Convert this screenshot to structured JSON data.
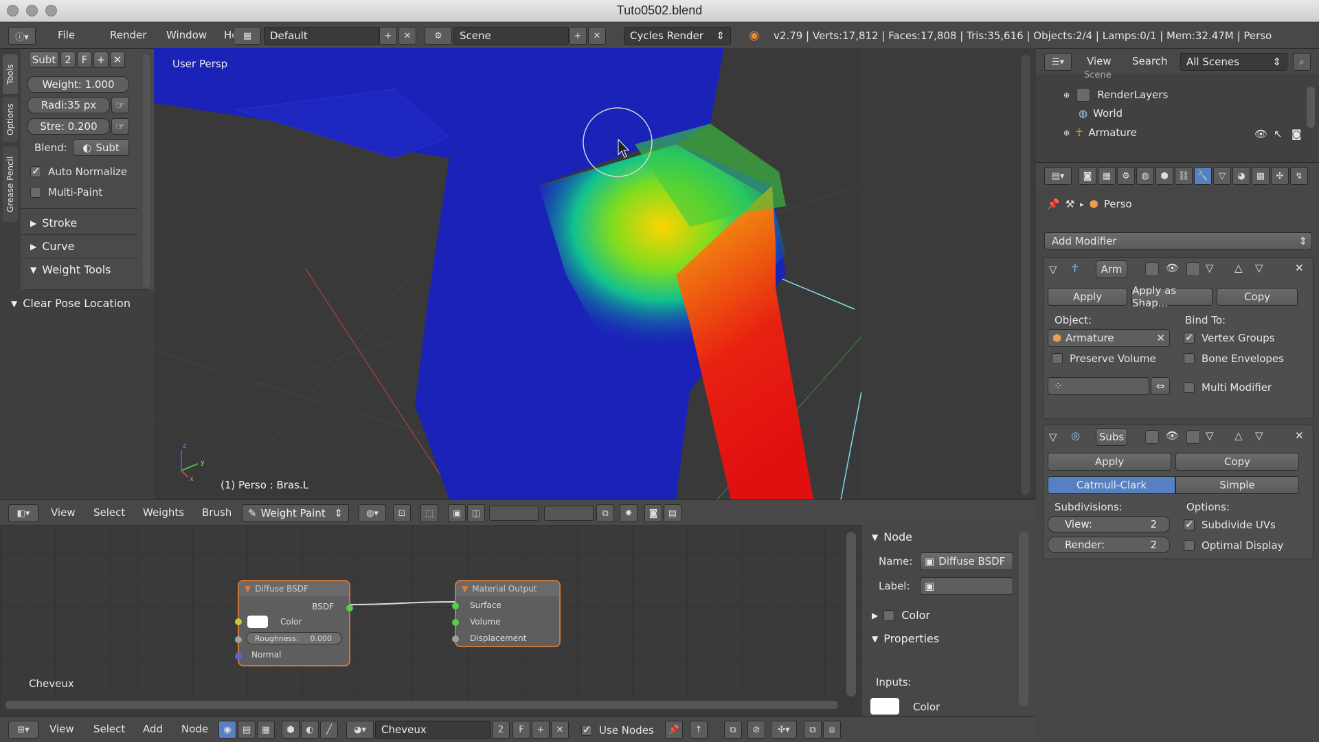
{
  "window": {
    "title": "Tuto0502.blend"
  },
  "infobar": {
    "menus": [
      "File",
      "Render",
      "Window",
      "Help"
    ],
    "layout": "Default",
    "scene": "Scene",
    "engine": "Cycles Render",
    "stats": "v2.79 | Verts:17,812 | Faces:17,808 | Tris:35,616 | Objects:2/4 | Lamps:0/1 | Mem:32.47M | Perso"
  },
  "tools": {
    "tabs": [
      "Tools",
      "Options",
      "Grease Pencil"
    ],
    "brush_name": "Subt",
    "brush_users": "2",
    "brush_fake": "F",
    "weight": "Weight:  1.000",
    "radius": "Radi:35 px",
    "strength": "Stre:  0.200",
    "blend_label": "Blend:",
    "blend_value": "Subt",
    "auto_normalize": "Auto Normalize",
    "multi_paint": "Multi-Paint",
    "stroke": "Stroke",
    "curve": "Curve",
    "weight_tools": "Weight Tools",
    "clear_pose": "Clear Pose Location"
  },
  "viewport": {
    "label": "User Persp",
    "status": "(1) Perso : Bras.L",
    "axis_x": "x",
    "axis_y": "y",
    "axis_z": "z"
  },
  "viewheader": {
    "menus": [
      "View",
      "Select",
      "Weights",
      "Brush"
    ],
    "mode": "Weight Paint"
  },
  "nodes": {
    "diffuse": {
      "title": "Diffuse BSDF",
      "bsdf": "BSDF",
      "color": "Color",
      "roughness": "Roughness:",
      "roughness_value": "0.000",
      "normal": "Normal"
    },
    "output": {
      "title": "Material Output",
      "surface": "Surface",
      "volume": "Volume",
      "displacement": "Displacement"
    },
    "material_label": "Cheveux"
  },
  "nodepanel": {
    "node": "Node",
    "name_label": "Name:",
    "name_value": "Diffuse BSDF",
    "label_label": "Label:",
    "color": "Color",
    "properties": "Properties",
    "inputs": "Inputs:",
    "color_input": "Color"
  },
  "nodeheader": {
    "menus": [
      "View",
      "Select",
      "Add",
      "Node"
    ],
    "material": "Cheveux",
    "users": "2",
    "fake": "F",
    "use_nodes": "Use Nodes"
  },
  "outliner": {
    "menus": [
      "View",
      "Search"
    ],
    "filter": "All Scenes",
    "items": [
      "Scene",
      "RenderLayers",
      "World",
      "Armature"
    ]
  },
  "properties": {
    "breadcrumb": "Perso",
    "add_modifier": "Add Modifier",
    "armature_mod": {
      "name": "Arm",
      "apply": "Apply",
      "apply_shape": "Apply as Shap...",
      "copy": "Copy",
      "object_label": "Object:",
      "object_value": "Armature",
      "bind_to": "Bind To:",
      "vertex_groups": "Vertex Groups",
      "preserve_volume": "Preserve Volume",
      "bone_envelopes": "Bone Envelopes",
      "multi_modifier": "Multi Modifier"
    },
    "subsurf_mod": {
      "name": "Subs",
      "apply": "Apply",
      "copy": "Copy",
      "catmull": "Catmull-Clark",
      "simple": "Simple",
      "subdivisions": "Subdivisions:",
      "options": "Options:",
      "view": "View:",
      "view_value": "2",
      "render": "Render:",
      "render_value": "2",
      "subdivide_uvs": "Subdivide UVs",
      "optimal_display": "Optimal Display"
    }
  },
  "colors": {
    "accent": "#5680c2",
    "node_border": "#c9783a",
    "header": "#484848"
  }
}
